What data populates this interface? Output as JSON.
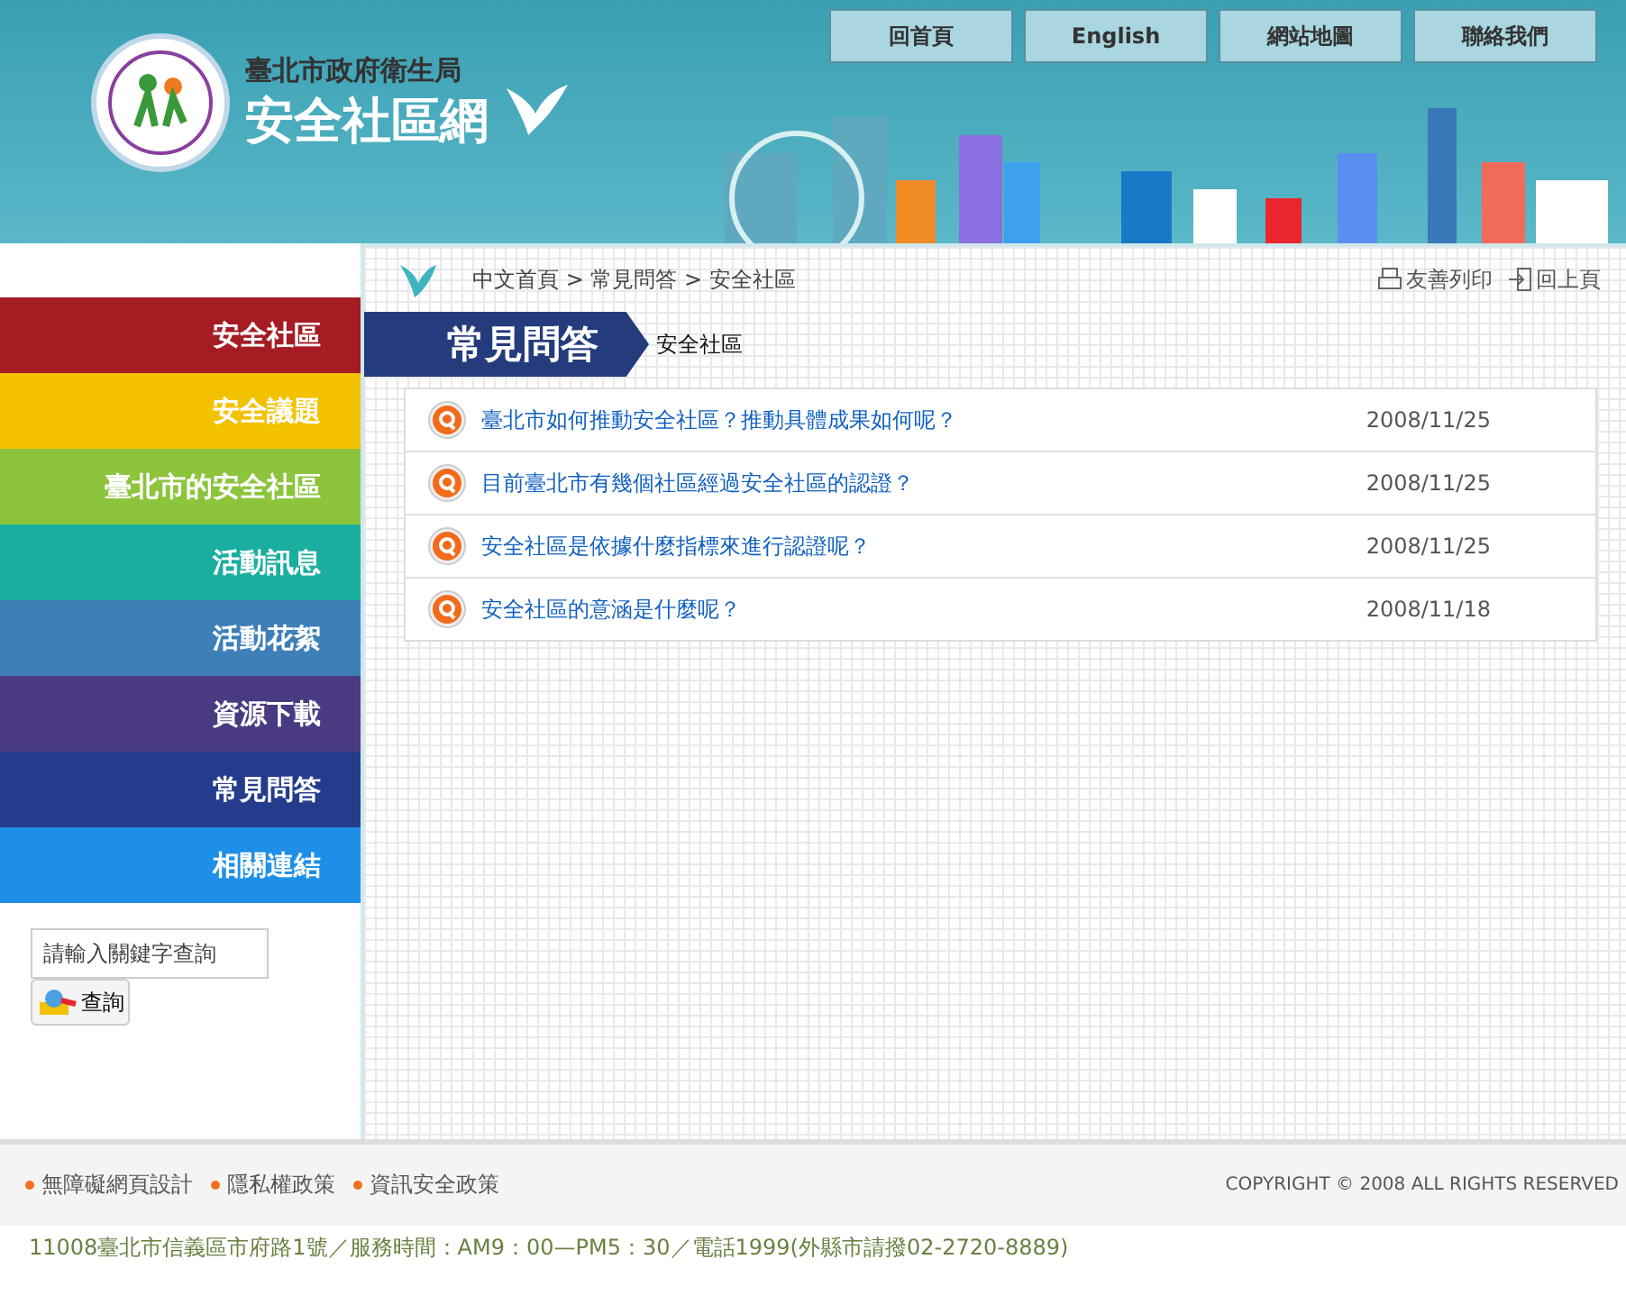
{
  "header": {
    "agency": "臺北市政府衛生局",
    "site_title": "安全社區網",
    "top_links": [
      "回首頁",
      "English",
      "網站地圖",
      "聯絡我們"
    ]
  },
  "sidebar": {
    "items": [
      {
        "label": "安全社區",
        "color": "#a51c22"
      },
      {
        "label": "安全議題",
        "color": "#f2c200"
      },
      {
        "label": "臺北市的安全社區",
        "color": "#8cc43c"
      },
      {
        "label": "活動訊息",
        "color": "#1aaea0"
      },
      {
        "label": "活動花絮",
        "color": "#3e7fb8"
      },
      {
        "label": "資源下載",
        "color": "#4a3a82"
      },
      {
        "label": "常見問答",
        "color": "#253c8c"
      },
      {
        "label": "相關連結",
        "color": "#1e8fe6"
      }
    ],
    "search": {
      "placeholder": "請輸入關鍵字查詢",
      "button": "查詢"
    }
  },
  "breadcrumb": "中文首頁 > 常見問答 > 安全社區",
  "tools": [
    "友善列印",
    "回上頁"
  ],
  "section": {
    "title": "常見問答",
    "subtitle": "安全社區"
  },
  "faq": [
    {
      "question": "臺北市如何推動安全社區？推動具體成果如何呢？",
      "date": "2008/11/25"
    },
    {
      "question": "目前臺北市有幾個社區經過安全社區的認證？",
      "date": "2008/11/25"
    },
    {
      "question": "安全社區是依據什麼指標來進行認證呢？",
      "date": "2008/11/25"
    },
    {
      "question": "安全社區的意涵是什麼呢？",
      "date": "2008/11/18"
    }
  ],
  "footer": {
    "links": [
      "無障礙網頁設計",
      "隱私權政策",
      "資訊安全政策"
    ],
    "copyright": "COPYRIGHT © 2008 ALL RIGHTS RESERVED",
    "address": "11008臺北市信義區市府路1號／服務時間：AM9：00—PM5：30／電話1999(外縣市請撥02-2720-8889)"
  }
}
